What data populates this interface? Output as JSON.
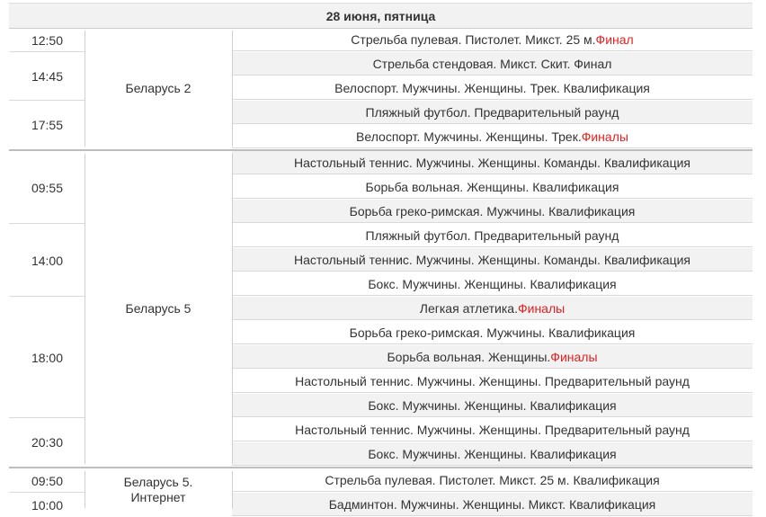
{
  "header": {
    "date": "28 июня, пятница"
  },
  "final_color": "#e02020",
  "blocks": [
    {
      "channel": "Беларусь 2",
      "groups": [
        {
          "time": "12:50",
          "events": [
            {
              "text": "Стрельба пулевая. Пистолет. Микст. 25 м.",
              "final": "Финал"
            }
          ]
        },
        {
          "time": "14:45",
          "events": [
            {
              "text": "Стрельба стендовая. Микст. Скит. Финал",
              "final": ""
            },
            {
              "text": "Велоспорт. Мужчины. Женщины. Трек. Квалификация",
              "final": ""
            }
          ]
        },
        {
          "time": "17:55",
          "events": [
            {
              "text": "Пляжный футбол. Предварительный раунд",
              "final": ""
            },
            {
              "text": "Велоспорт. Мужчины. Женщины. Трек.",
              "final": "Финалы"
            }
          ]
        }
      ]
    },
    {
      "channel": "Беларусь 5",
      "groups": [
        {
          "time": "09:55",
          "events": [
            {
              "text": "Настольный теннис. Мужчины. Женщины. Команды. Квалификация",
              "final": ""
            },
            {
              "text": "Борьба вольная. Женщины. Квалификация",
              "final": ""
            },
            {
              "text": "Борьба греко-римская. Мужчины. Квалификация",
              "final": ""
            }
          ]
        },
        {
          "time": "14:00",
          "events": [
            {
              "text": "Пляжный футбол. Предварительный раунд",
              "final": ""
            },
            {
              "text": "Настольный теннис. Мужчины. Женщины. Команды. Квалификация",
              "final": ""
            },
            {
              "text": "Бокс. Мужчины. Женщины. Квалификация",
              "final": ""
            }
          ]
        },
        {
          "time": "18:00",
          "events": [
            {
              "text": "Легкая атлетика.",
              "final": "Финалы"
            },
            {
              "text": "Борьба греко-римская. Мужчины. Квалификация",
              "final": ""
            },
            {
              "text": "Борьба вольная. Женщины.",
              "final": "Финалы"
            },
            {
              "text": "Настольный теннис. Мужчины. Женщины. Предварительный раунд",
              "final": ""
            },
            {
              "text": "Бокс. Мужчины. Женщины. Квалификация",
              "final": ""
            }
          ]
        },
        {
          "time": "20:30",
          "events": [
            {
              "text": "Настольный теннис. Мужчины. Женщины. Предварительный раунд",
              "final": ""
            },
            {
              "text": "Бокс. Мужчины. Женщины. Квалификация",
              "final": ""
            }
          ]
        }
      ]
    },
    {
      "channel": "Беларусь 5. Интернет",
      "groups": [
        {
          "time": "09:50",
          "events": [
            {
              "text": "Стрельба пулевая. Пистолет. Микст. 25 м. Квалификация",
              "final": ""
            }
          ]
        },
        {
          "time": "10:00",
          "events": [
            {
              "text": "Бадминтон. Мужчины. Женщины. Микст. Квалификация",
              "final": ""
            }
          ]
        }
      ]
    }
  ]
}
